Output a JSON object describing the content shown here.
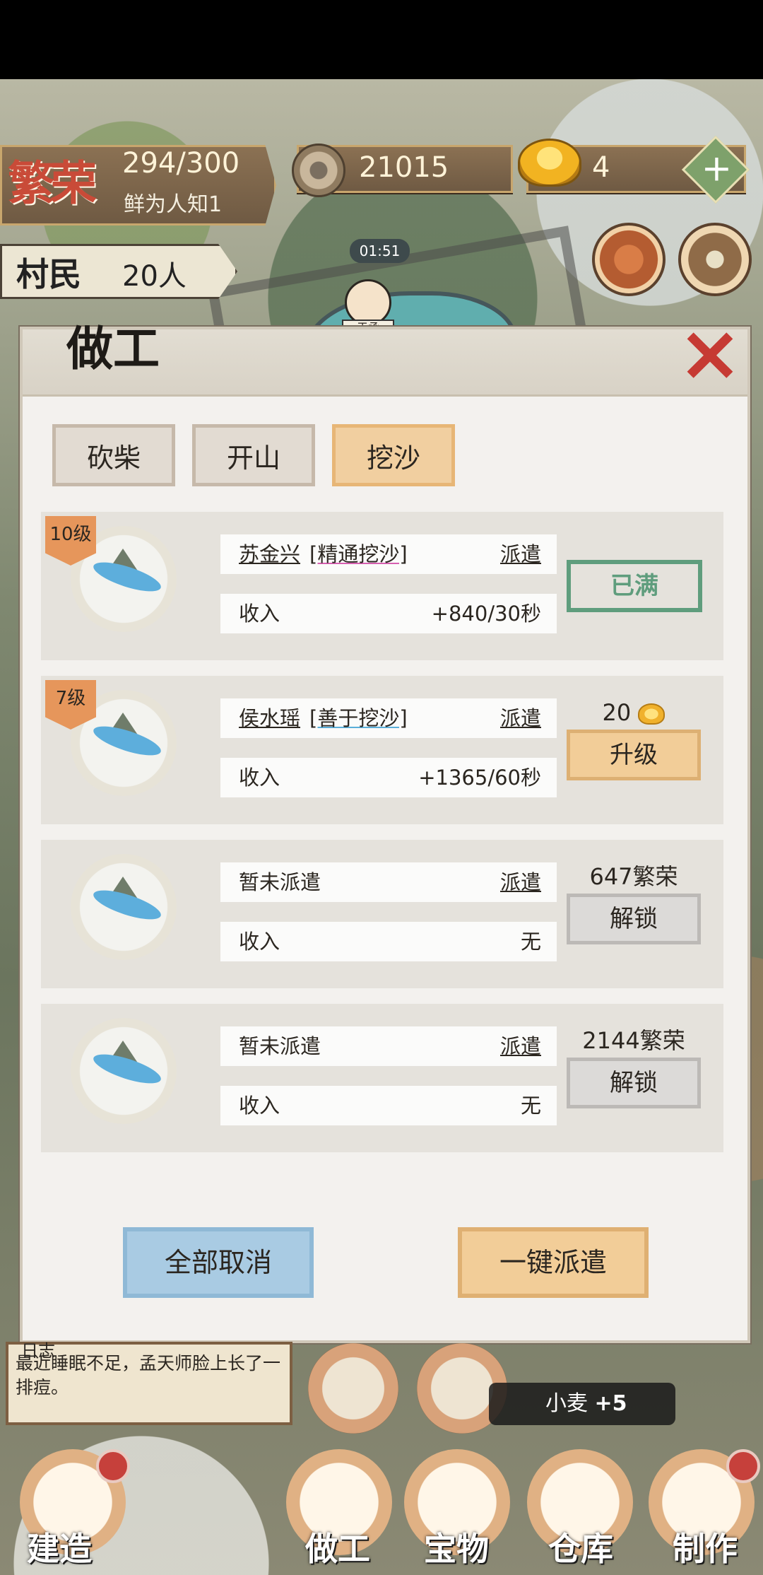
{
  "hud": {
    "prosperity_title": "繁荣",
    "prosperity_value": "294/300",
    "prosperity_rank": "鲜为人知1",
    "coins": "21015",
    "ingots": "4",
    "plus": "+",
    "villagers_label": "村民",
    "villagers_value": "20人",
    "timer": "01:51",
    "npc_name": "于承"
  },
  "dialog": {
    "title": "做工",
    "close": "×",
    "tabs": [
      {
        "label": "砍柴"
      },
      {
        "label": "开山"
      },
      {
        "label": "挖沙"
      }
    ],
    "active_tab": "挖沙",
    "slots": [
      {
        "level": "10级",
        "worker": "苏金兴",
        "skill": "[精通挖沙]",
        "dispatch": "派遣",
        "income_label": "收入",
        "income": "+840/30秒",
        "button": "已满"
      },
      {
        "level": "7级",
        "worker": "侯水瑶",
        "skill": "[善于挖沙]",
        "dispatch": "派遣",
        "income_label": "收入",
        "income": "+1365/60秒",
        "price": "20",
        "button": "升级"
      },
      {
        "worker": "暂未派遣",
        "dispatch": "派遣",
        "income_label": "收入",
        "income": "无",
        "price": "647繁荣",
        "button": "解锁"
      },
      {
        "worker": "暂未派遣",
        "dispatch": "派遣",
        "income_label": "收入",
        "income": "无",
        "price": "2144繁荣",
        "button": "解锁"
      }
    ],
    "footer": {
      "cancel_all": "全部取消",
      "dispatch_all": "一键派遣"
    }
  },
  "log": {
    "header": "日志",
    "text": "最近睡眠不足，孟天师脸上长了一排痘。"
  },
  "toast": {
    "item": "小麦",
    "amount": "+5"
  },
  "bottom_nav": [
    {
      "label": "建造"
    },
    {
      "label": "做工"
    },
    {
      "label": "宝物"
    },
    {
      "label": "仓库"
    },
    {
      "label": "制作"
    }
  ]
}
